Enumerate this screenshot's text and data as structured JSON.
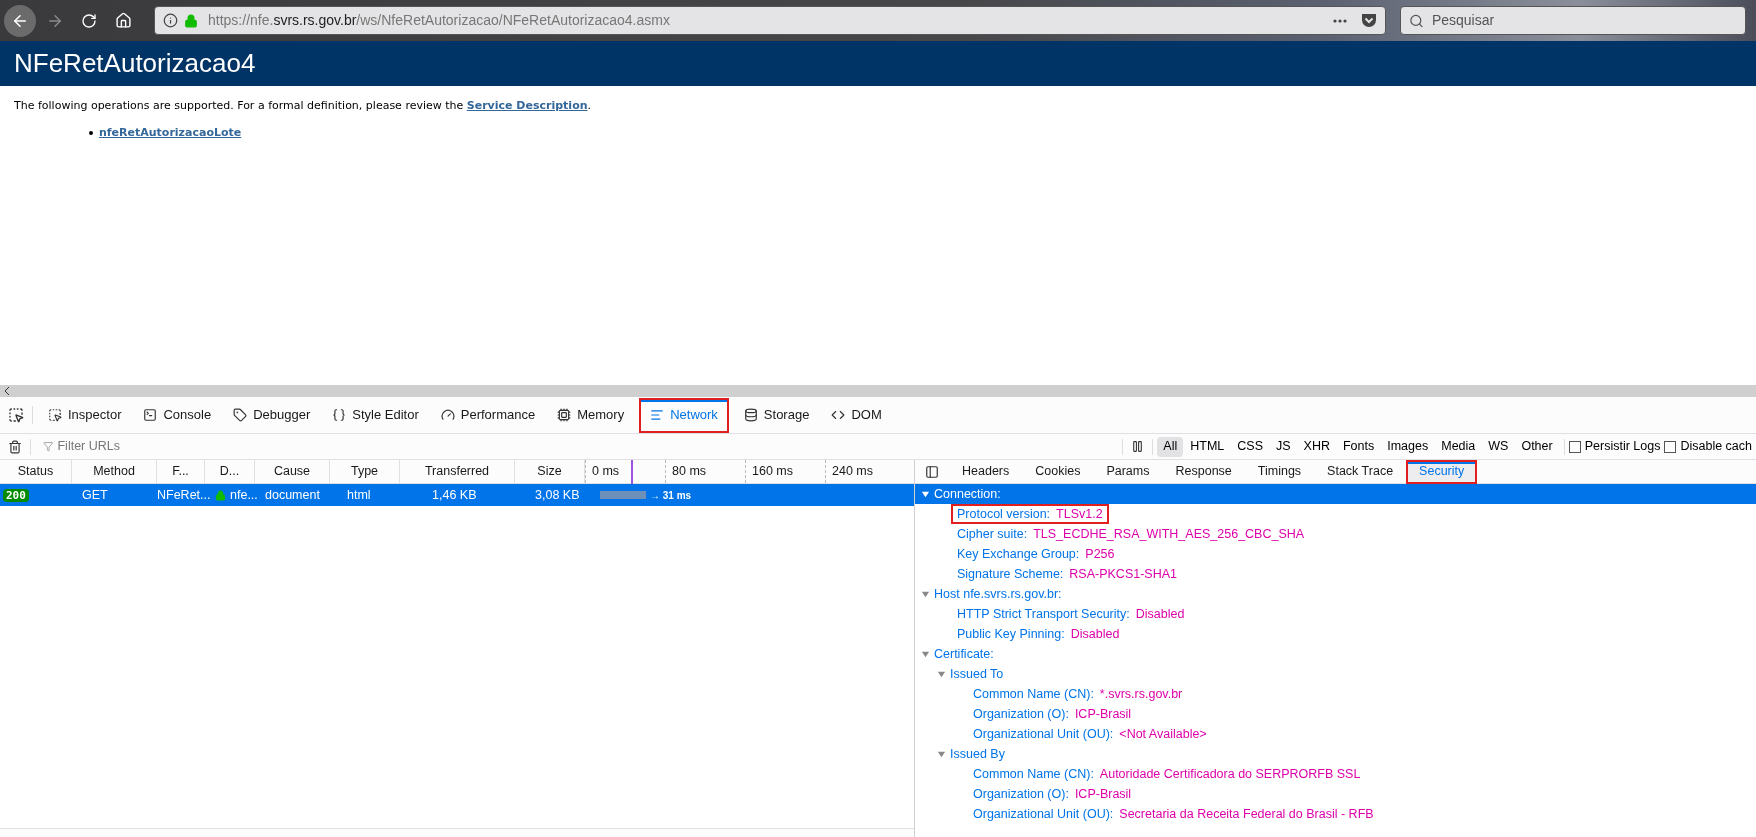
{
  "browser": {
    "url": {
      "scheme": "https://nfe.",
      "domain": "svrs.rs.gov.br",
      "path": "/ws/NfeRetAutorizacao/NFeRetAutorizacao4.asmx"
    },
    "forward_disabled": true,
    "search": {
      "placeholder": "Pesquisar"
    }
  },
  "page": {
    "title": "NFeRetAutorizacao4",
    "intro": {
      "before": "The following operations are supported. For a formal definition, please review the ",
      "link": "Service Description",
      "after": "."
    },
    "operations": [
      "nfeRetAutorizacaoLote"
    ]
  },
  "devtools": {
    "tabs": [
      {
        "label": "Inspector",
        "selected": false,
        "highlighted": false
      },
      {
        "label": "Console",
        "selected": false,
        "highlighted": false
      },
      {
        "label": "Debugger",
        "selected": false,
        "highlighted": false
      },
      {
        "label": "Style Editor",
        "selected": false,
        "highlighted": false
      },
      {
        "label": "Performance",
        "selected": false,
        "highlighted": false
      },
      {
        "label": "Memory",
        "selected": false,
        "highlighted": false
      },
      {
        "label": "Network",
        "selected": true,
        "highlighted": true
      },
      {
        "label": "Storage",
        "selected": false,
        "highlighted": false
      },
      {
        "label": "DOM",
        "selected": false,
        "highlighted": false
      }
    ],
    "filter": {
      "placeholder": "Filter URLs"
    },
    "type_filters": [
      {
        "label": "All",
        "selected": true
      },
      {
        "label": "HTML",
        "selected": false
      },
      {
        "label": "CSS",
        "selected": false
      },
      {
        "label": "JS",
        "selected": false
      },
      {
        "label": "XHR",
        "selected": false
      },
      {
        "label": "Fonts",
        "selected": false
      },
      {
        "label": "Images",
        "selected": false
      },
      {
        "label": "Media",
        "selected": false
      },
      {
        "label": "WS",
        "selected": false
      },
      {
        "label": "Other",
        "selected": false
      }
    ],
    "options": [
      {
        "label": "Persistir Logs",
        "checked": false
      },
      {
        "label": "Disable cach",
        "checked": false
      }
    ],
    "columns": [
      "Status",
      "Method",
      "F...",
      "D...",
      "Cause",
      "Type",
      "Transferred",
      "Size"
    ],
    "timeline_ticks": [
      "0 ms",
      "80 ms",
      "160 ms",
      "240 ms"
    ],
    "requests": [
      {
        "status": "200",
        "method": "GET",
        "file": "NFeRet...",
        "domain": "nfe...",
        "cause": "document",
        "type": "html",
        "transferred": "1,46 KB",
        "size": "3,08 KB",
        "timing": "→ 31 ms",
        "selected": true
      }
    ],
    "detail_tabs": [
      {
        "label": "Headers",
        "selected": false,
        "highlighted": false
      },
      {
        "label": "Cookies",
        "selected": false,
        "highlighted": false
      },
      {
        "label": "Params",
        "selected": false,
        "highlighted": false
      },
      {
        "label": "Response",
        "selected": false,
        "highlighted": false
      },
      {
        "label": "Timings",
        "selected": false,
        "highlighted": false
      },
      {
        "label": "Stack Trace",
        "selected": false,
        "highlighted": false
      },
      {
        "label": "Security",
        "selected": true,
        "highlighted": true
      }
    ],
    "security_tree": [
      {
        "label": "Connection:",
        "expanded": true,
        "selected": true,
        "children": [
          {
            "label": "Protocol version:",
            "value": "TLSv1.2",
            "highlighted": true
          },
          {
            "label": "Cipher suite:",
            "value": "TLS_ECDHE_RSA_WITH_AES_256_CBC_SHA",
            "highlighted": false
          },
          {
            "label": "Key Exchange Group:",
            "value": "P256",
            "highlighted": false
          },
          {
            "label": "Signature Scheme:",
            "value": "RSA-PKCS1-SHA1",
            "highlighted": false
          }
        ]
      },
      {
        "label": "Host nfe.svrs.rs.gov.br:",
        "expanded": true,
        "selected": false,
        "children": [
          {
            "label": "HTTP Strict Transport Security:",
            "value": "Disabled",
            "highlighted": false
          },
          {
            "label": "Public Key Pinning:",
            "value": "Disabled",
            "highlighted": false
          }
        ]
      },
      {
        "label": "Certificate:",
        "expanded": true,
        "selected": false,
        "children": [
          {
            "label": "Issued To",
            "expanded": true,
            "selected": false,
            "children": [
              {
                "label": "Common Name (CN):",
                "value": "*.svrs.rs.gov.br",
                "highlighted": false
              },
              {
                "label": "Organization (O):",
                "value": "ICP-Brasil",
                "highlighted": false
              },
              {
                "label": "Organizational Unit (OU):",
                "value": "<Not Available>",
                "highlighted": false
              }
            ]
          },
          {
            "label": "Issued By",
            "expanded": true,
            "selected": false,
            "children": [
              {
                "label": "Common Name (CN):",
                "value": "Autoridade Certificadora do SERPRORFB SSL",
                "highlighted": false
              },
              {
                "label": "Organization (O):",
                "value": "ICP-Brasil",
                "highlighted": false
              },
              {
                "label": "Organizational Unit (OU):",
                "value": "Secretaria da Receita Federal do Brasil - RFB",
                "highlighted": false
              }
            ]
          }
        ]
      }
    ]
  }
}
